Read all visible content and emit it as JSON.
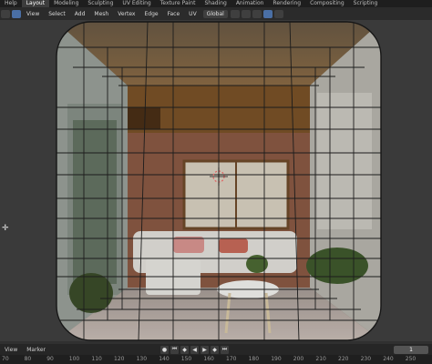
{
  "workspace_tabs": [
    "Help",
    "Layout",
    "Modeling",
    "Sculpting",
    "UV Editing",
    "Texture Paint",
    "Shading",
    "Animation",
    "Rendering",
    "Compositing",
    "Scripting"
  ],
  "active_tab": "Layout",
  "header": {
    "menus": [
      "View",
      "Select",
      "Add",
      "Mesh",
      "Vertex",
      "Edge",
      "Face",
      "UV"
    ],
    "transform": "Global"
  },
  "timeline": {
    "menus": [
      "View",
      "Marker"
    ],
    "frame": "1",
    "ruler": [
      "70",
      "80",
      "90",
      "100",
      "110",
      "120",
      "130",
      "140",
      "150",
      "160",
      "170",
      "180",
      "190",
      "200",
      "210",
      "220",
      "230",
      "240",
      "250"
    ]
  }
}
